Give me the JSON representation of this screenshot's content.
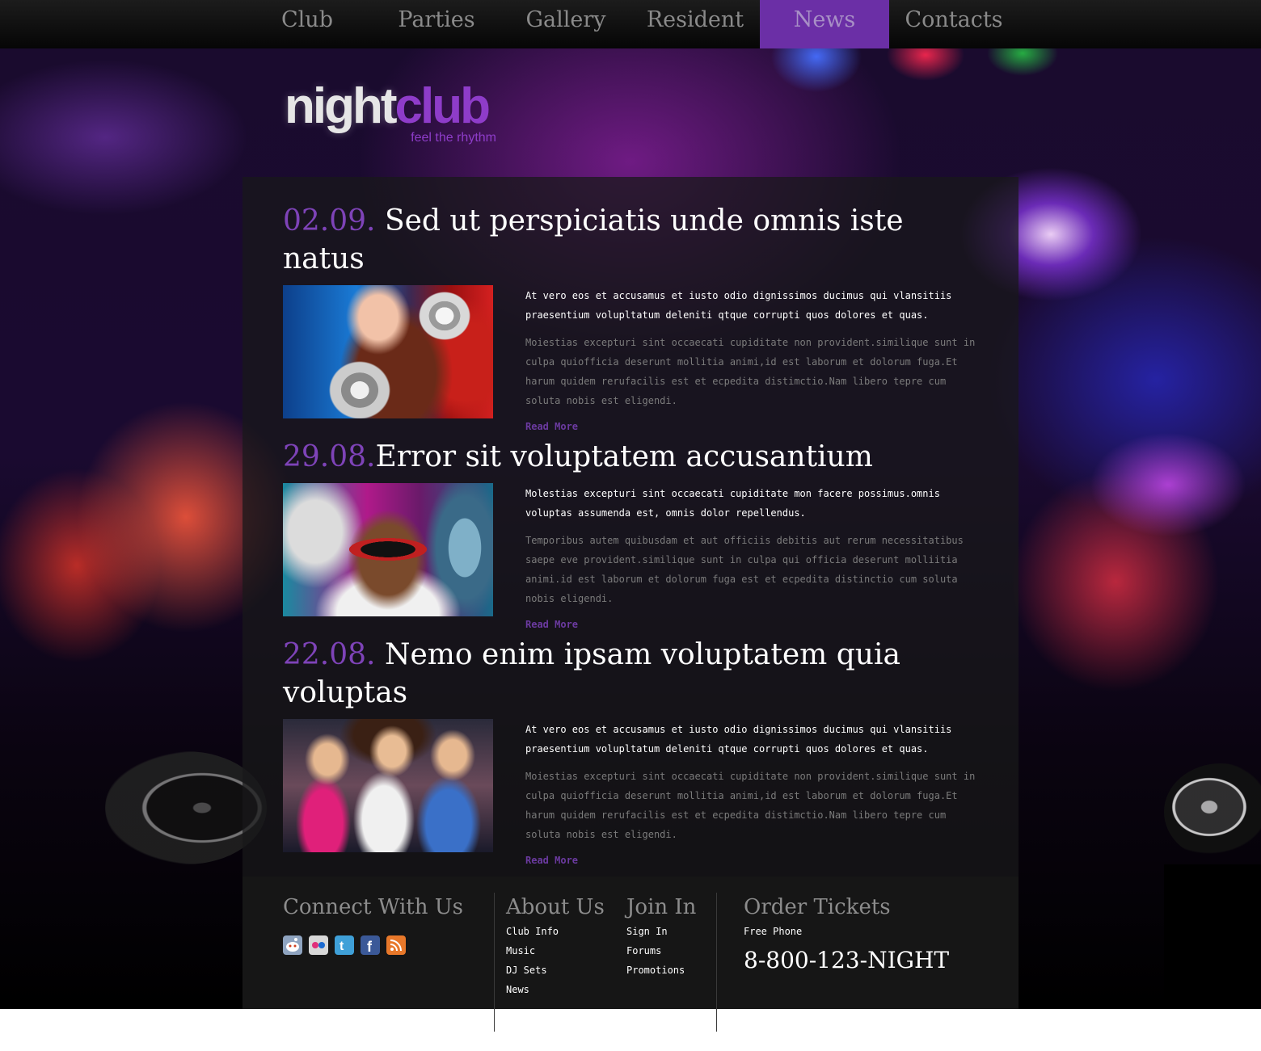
{
  "nav": {
    "items": [
      {
        "label": "Club"
      },
      {
        "label": "Parties"
      },
      {
        "label": "Gallery"
      },
      {
        "label": "Resident"
      },
      {
        "label": "News",
        "active": true
      },
      {
        "label": "Contacts"
      }
    ]
  },
  "logo": {
    "word1": "night",
    "word2": "club",
    "tagline": "feel the rhythm"
  },
  "posts": [
    {
      "date": "02.09.",
      "title": "Sed ut perspiciatis unde omnis iste natus",
      "lead": "At vero eos et accusamus et iusto odio dignissimos ducimus qui vlansitiis praesentium volupltatum deleniti qtque corrupti quos dolores et quas.",
      "body": "Moiestias excepturi sint occaecati cupiditate non provident.similique sunt in culpa quiofficia deserunt mollitia animi,id est laborum et dolorum fuga.Et harum quidem rerufacilis est et ecpedita distimctio.Nam libero tepre cum soluta nobis est eligendi.",
      "more": "Read More",
      "image": "woman-with-disco-balls-photo"
    },
    {
      "date": "29.08.",
      "title": "Error sit voluptatem accusantium",
      "lead": "Molestias excepturi sint occaecati cupiditate mon facere possimus.omnis voluptas assumenda est, omnis dolor repellendus.",
      "body": "Temporibus autem quibusdam et aut officiis debitis aut rerum necessitatibus saepe eve provident.similique sunt in culpa qui officia deserunt molliitia animi.id est laborum et dolorum fuga est et ecpedita distinctio cum soluta nobis eligendi.",
      "more": "Read More",
      "image": "man-with-sunglasses-photo"
    },
    {
      "date": "22.08.",
      "title": "Nemo enim ipsam voluptatem quia voluptas",
      "lead": "At vero eos et accusamus et iusto odio dignissimos ducimus qui vlansitiis praesentium volupltatum deleniti qtque corrupti quos dolores et quas.",
      "body": "Moiestias excepturi sint occaecati cupiditate non provident.similique sunt in culpa quiofficia deserunt mollitia animi,id est laborum et dolorum fuga.Et harum quidem rerufacilis est et ecpedita distimctio.Nam libero tepre cum soluta nobis est eligendi.",
      "more": "Read More",
      "image": "dancing-girls-photo"
    }
  ],
  "footer": {
    "connect": {
      "heading": "Connect With Us",
      "icons": [
        {
          "name": "reddit-icon",
          "color": "#8fa4c0"
        },
        {
          "name": "flickr-icon",
          "color": "#d8d8d8"
        },
        {
          "name": "twitter-icon",
          "color": "#3fa0d8"
        },
        {
          "name": "facebook-icon",
          "color": "#3b5998"
        },
        {
          "name": "rss-icon",
          "color": "#e8782a"
        }
      ]
    },
    "about": {
      "heading": "About Us",
      "links": [
        "Club Info",
        "Music",
        "DJ Sets",
        "News"
      ]
    },
    "join": {
      "heading": "Join In",
      "links": [
        "Sign In",
        "Forums",
        "Promotions"
      ]
    },
    "tickets": {
      "heading": "Order Tickets",
      "label": "Free Phone",
      "phone": "8-800-123-NIGHT"
    }
  },
  "colors": {
    "accent": "#6b2fa6",
    "date": "#7e43b8",
    "read_more": "#6b3aa0",
    "panel": "#18181a"
  }
}
